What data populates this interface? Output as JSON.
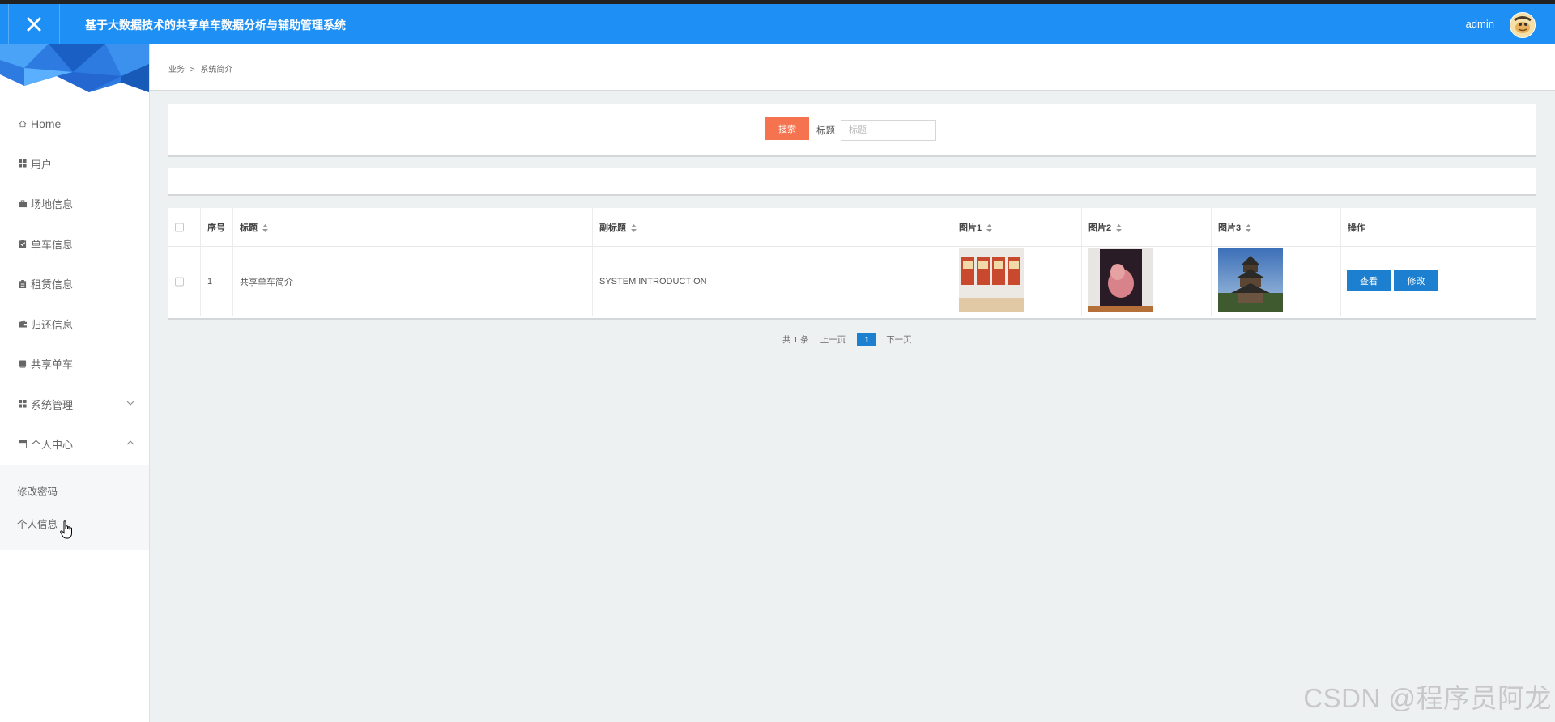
{
  "header": {
    "title": "基于大数据技术的共享单车数据分析与辅助管理系统",
    "user_name": "admin",
    "brand_color": "#1e90f5"
  },
  "sidebar": {
    "items": [
      {
        "label": "Home",
        "icon": "home-icon"
      },
      {
        "label": "用户",
        "icon": "grid-icon"
      },
      {
        "label": "场地信息",
        "icon": "briefcase-icon"
      },
      {
        "label": "单车信息",
        "icon": "clipboard-icon"
      },
      {
        "label": "租赁信息",
        "icon": "clipboard-icon"
      },
      {
        "label": "归还信息",
        "icon": "wallet-icon"
      },
      {
        "label": "共享单车",
        "icon": "tablet-icon"
      },
      {
        "label": "系统管理",
        "icon": "grid-icon",
        "expanded": false
      },
      {
        "label": "个人中心",
        "icon": "window-icon",
        "expanded": true
      }
    ],
    "submenu": [
      {
        "label": "修改密码"
      },
      {
        "label": "个人信息"
      }
    ]
  },
  "breadcrumb": {
    "parent": "业务",
    "separator": ">",
    "current": "系统简介"
  },
  "search": {
    "button_label": "搜索",
    "field_label": "标题",
    "placeholder": "标题",
    "button_color": "#f5734f"
  },
  "table": {
    "headers": {
      "index": "序号",
      "title": "标题",
      "subtitle": "副标题",
      "image1": "图片1",
      "image2": "图片2",
      "image3": "图片3",
      "actions": "操作"
    },
    "rows": [
      {
        "index": "1",
        "title": "共享单车简介",
        "subtitle": "SYSTEM INTRODUCTION",
        "view_label": "查看",
        "edit_label": "修改"
      }
    ]
  },
  "pagination": {
    "total": "共 1 条",
    "prev": "上一页",
    "current": "1",
    "next": "下一页",
    "accent": "#1c7fcf"
  },
  "watermark": "CSDN @程序员阿龙"
}
